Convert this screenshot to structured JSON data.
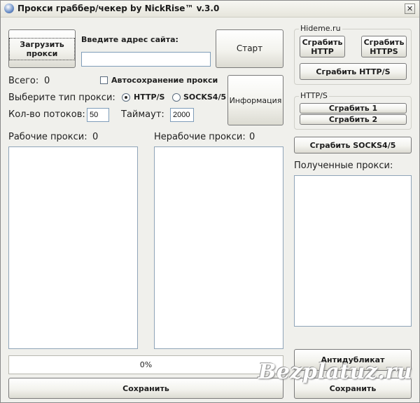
{
  "window": {
    "title": "Прокси граббер/чекер by NickRise™ v.3.0",
    "close_glyph": "✕"
  },
  "top": {
    "load_button": "Загрузить прокси",
    "address_label": "Введите адрес сайта:",
    "address_value": "",
    "start_button": "Старт",
    "info_button": "Информация"
  },
  "stats": {
    "total_label": "Всего:",
    "total_value": "0"
  },
  "autosave": {
    "label": "Автосохранение прокси",
    "checked": false
  },
  "proxy_type": {
    "label": "Выберите тип прокси:",
    "options": [
      "HTTP/S",
      "SOCKS4/5"
    ],
    "selected": "HTTP/S"
  },
  "threads": {
    "label": "Кол-во потоков:",
    "value": "50"
  },
  "timeout": {
    "label": "Таймаут:",
    "value": "2000"
  },
  "working": {
    "label": "Рабочие прокси:",
    "count": "0"
  },
  "broken": {
    "label": "Нерабочие прокси:",
    "count": "0"
  },
  "progress": {
    "text": "0%",
    "percent": 0
  },
  "save_left": "Сохранить",
  "hideme": {
    "title": "Hideme.ru",
    "grab_http": "Сграбить HTTP",
    "grab_https": "Сграбить HTTPS",
    "grab_https_slash": "Сграбить HTTP/S"
  },
  "https_group": {
    "title": "HTTP/S",
    "grab1": "Сграбить 1",
    "grab2": "Сграбить 2"
  },
  "grab_socks": "Сграбить SOCKS4/5",
  "received": {
    "label": "Полученные прокси:"
  },
  "antidup_button": "Антидубликат",
  "save_right": "Сохранить",
  "watermark": "Bezplatuz.ru"
}
